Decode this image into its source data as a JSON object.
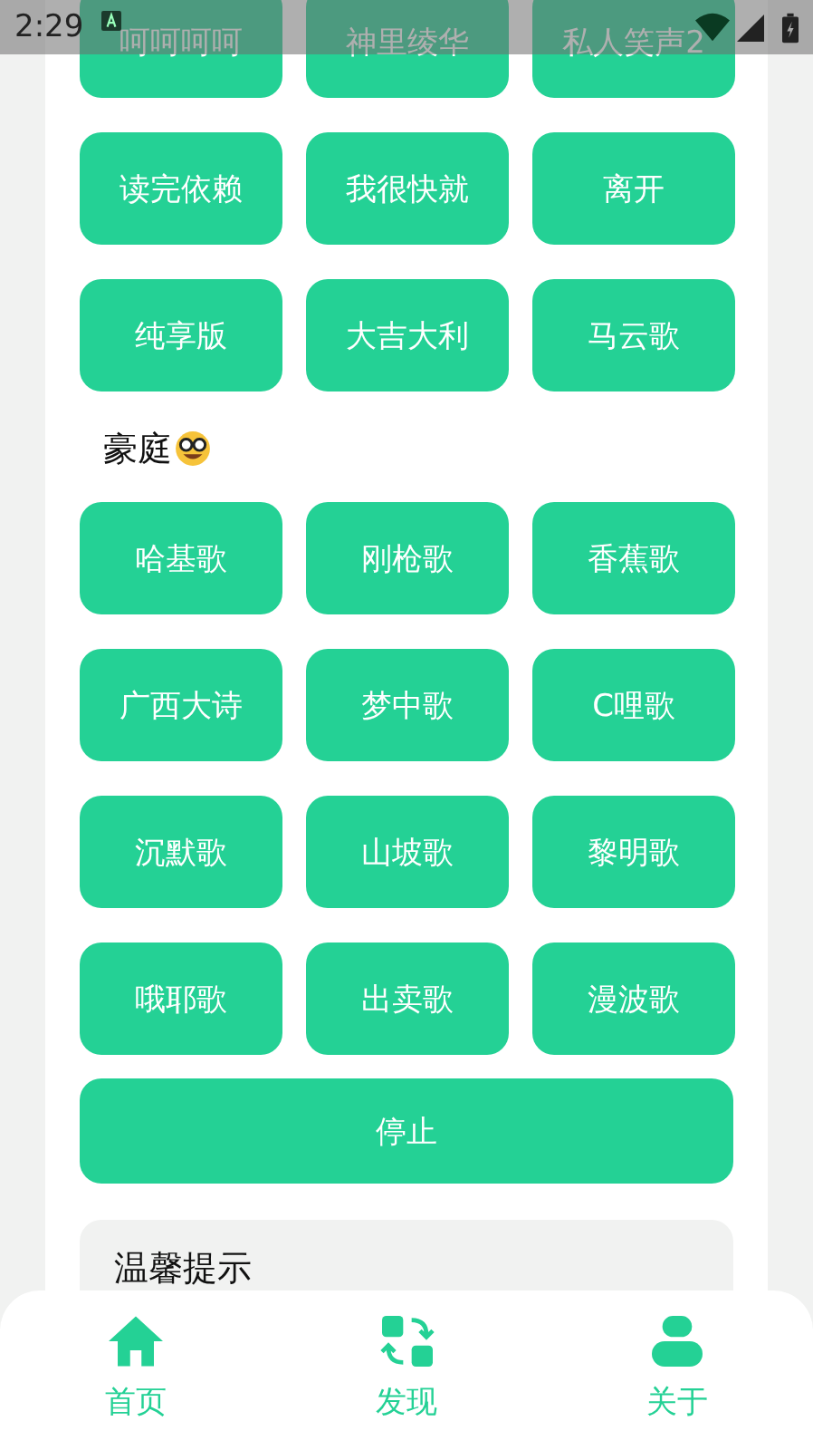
{
  "status_bar": {
    "time": "2:29"
  },
  "sections": [
    {
      "buttons": [
        "呵呵呵呵",
        "神里绫华",
        "私人笑声2",
        "读完依赖",
        "我很快就",
        "离开",
        "纯享版",
        "大吉大利",
        "马云歌"
      ]
    },
    {
      "title": "豪庭",
      "buttons": [
        "哈基歌",
        "刚枪歌",
        "香蕉歌",
        "广西大诗",
        "梦中歌",
        "C哩歌",
        "沉默歌",
        "山坡歌",
        "黎明歌",
        "哦耶歌",
        "出卖歌",
        "漫波歌"
      ]
    }
  ],
  "stop_button": "停止",
  "tip": {
    "title": "温馨提示"
  },
  "nav": [
    {
      "kind": "home",
      "label": "首页"
    },
    {
      "kind": "discover",
      "label": "发现"
    },
    {
      "kind": "about",
      "label": "关于"
    }
  ]
}
